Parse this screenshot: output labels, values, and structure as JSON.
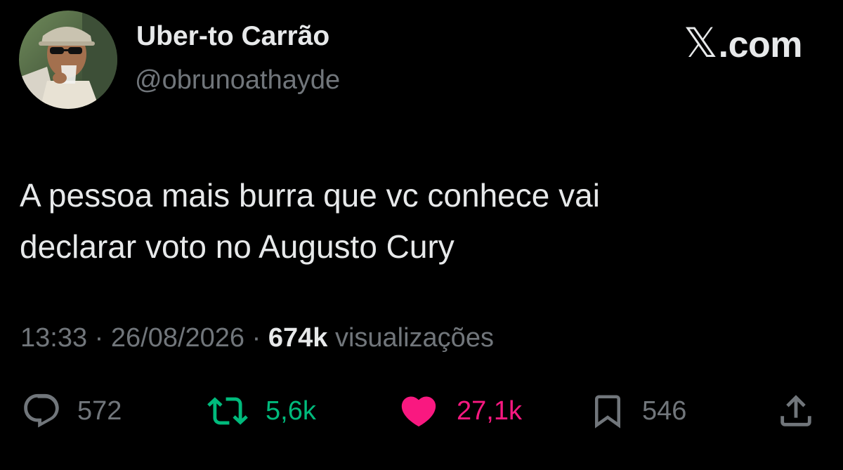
{
  "author": {
    "display_name": "Uber-to Carrão",
    "handle": "@obrunoathayde",
    "avatar_icon": "profile-photo-man-with-cap-and-sunglasses"
  },
  "brand": {
    "mark": "𝕏",
    "suffix": ".com"
  },
  "tweet": {
    "text_line1": "A pessoa mais burra que vc conhece vai",
    "text_line2": "declarar voto no Augusto Cury"
  },
  "meta": {
    "time": "13:33",
    "separator": "·",
    "date": "26/08/2026",
    "views_count": "674k",
    "views_label": "visualizações"
  },
  "actions": {
    "replies": {
      "icon": "reply-icon",
      "count": "572"
    },
    "retweets": {
      "icon": "retweet-icon",
      "count": "5,6k",
      "color": "#00ba7c"
    },
    "likes": {
      "icon": "heart-icon",
      "count": "27,1k",
      "color": "#f91880"
    },
    "bookmarks": {
      "icon": "bookmark-icon",
      "count": "546"
    },
    "share": {
      "icon": "share-icon"
    }
  },
  "colors": {
    "background": "#000000",
    "primary_text": "#e7e9ea",
    "secondary_text": "#71767b"
  }
}
